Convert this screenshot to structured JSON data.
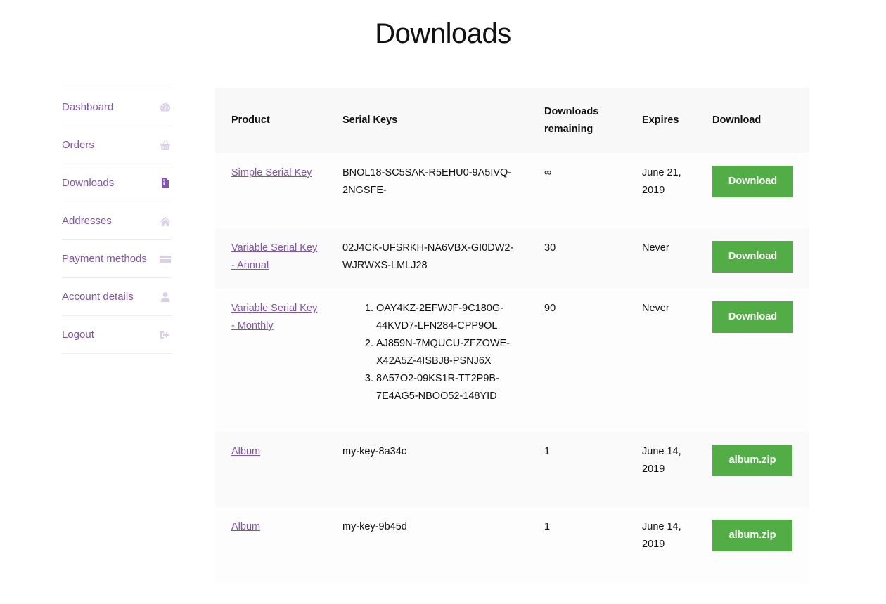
{
  "page": {
    "title": "Downloads"
  },
  "nav": {
    "items": [
      {
        "label": "Dashboard",
        "icon": "dashboard-gauge-icon",
        "active": false
      },
      {
        "label": "Orders",
        "icon": "basket-icon",
        "active": false
      },
      {
        "label": "Downloads",
        "icon": "file-archive-icon",
        "active": true
      },
      {
        "label": "Addresses",
        "icon": "home-icon",
        "active": false
      },
      {
        "label": "Payment methods",
        "icon": "credit-card-icon",
        "active": false
      },
      {
        "label": "Account details",
        "icon": "user-icon",
        "active": false
      },
      {
        "label": "Logout",
        "icon": "sign-out-icon",
        "active": false
      }
    ]
  },
  "table": {
    "headers": {
      "product": "Product",
      "serial_keys": "Serial Keys",
      "downloads_remaining": "Downloads remaining",
      "expires": "Expires",
      "download": "Download"
    },
    "rows": [
      {
        "product": "Simple Serial Key",
        "serial": "BNOL18-SC5SAK-R5EHU0-9A5IVQ-2NGSFE-",
        "remaining": "∞",
        "expires": "June 21, 2019",
        "button": "Download"
      },
      {
        "product": "Variable Serial Key - Annual",
        "serial": "02J4CK-UFSRKH-NA6VBX-GI0DW2-WJRWXS-LMLJ28",
        "remaining": "30",
        "expires": "Never",
        "button": "Download"
      },
      {
        "product": "Variable Serial Key - Monthly",
        "serial_list": [
          "OAY4KZ-2EFWJF-9C180G-44KVD7-LFN284-CPP9OL",
          "AJ859N-7MQUCU-ZFZOWE-X42A5Z-4ISBJ8-PSNJ6X",
          "8A57O2-09KS1R-TT2P9B-7E4AG5-NBOO52-148YID"
        ],
        "remaining": "90",
        "expires": "Never",
        "button": "Download"
      },
      {
        "product": "Album",
        "serial": "my-key-8a34c",
        "remaining": "1",
        "expires": "June 14, 2019",
        "button": "album.zip"
      },
      {
        "product": "Album",
        "serial": "my-key-9b45d",
        "remaining": "1",
        "expires": "June 14, 2019",
        "button": "album.zip"
      }
    ]
  },
  "colors": {
    "accent": "#7f54b3",
    "icon_inactive": "#dcd0e8",
    "button_green": "#53ad46",
    "header_bg": "#f8f8f8"
  }
}
